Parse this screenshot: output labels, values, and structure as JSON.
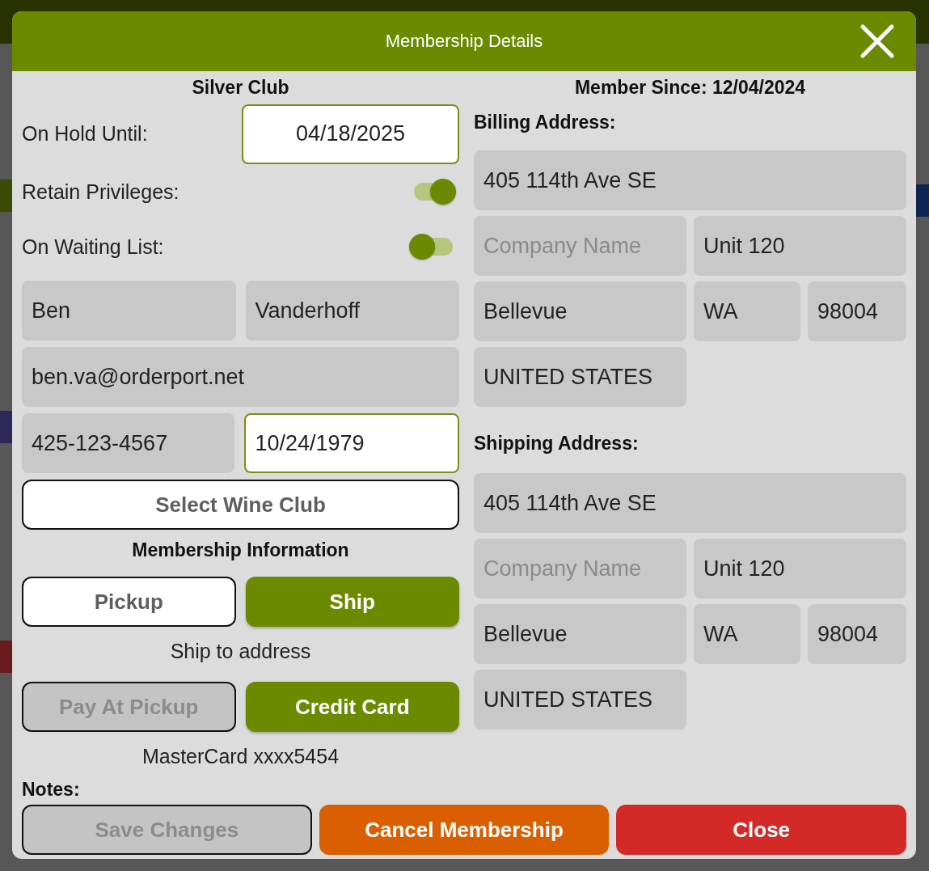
{
  "backdrop": {
    "left_edge": [
      {
        "color": "#3b4a05"
      },
      {
        "color": "#2e2858"
      },
      {
        "color": "#6a1c1c"
      }
    ],
    "right_edge": [
      {
        "color": "#0d2553"
      }
    ]
  },
  "dialog": {
    "title": "Membership Details",
    "club": "Silver Club",
    "member_since": "Member Since: 12/04/2024",
    "hold": {
      "label": "On Hold Until:",
      "value": "04/18/2025"
    },
    "toggles": [
      {
        "label": "Retain Privileges:",
        "on": true
      },
      {
        "label": "On Waiting List:",
        "on": false
      }
    ],
    "contact_rows": [
      [
        {
          "value": "Ben",
          "kind": "text"
        },
        {
          "value": "Vanderhoff",
          "kind": "text"
        }
      ],
      [
        {
          "value": "ben.va@orderport.net",
          "kind": "text"
        }
      ],
      [
        {
          "value": "425-123-4567",
          "kind": "text"
        },
        {
          "value": "10/24/1979",
          "kind": "date"
        }
      ]
    ],
    "select_club": "Select Wine Club",
    "membership_heading": "Membership Information",
    "delivery_options": [
      {
        "label": "Pickup",
        "selected": false,
        "disabled": false
      },
      {
        "label": "Ship",
        "selected": true,
        "disabled": false
      }
    ],
    "delivery_note": "Ship to address",
    "payment_options": [
      {
        "label": "Pay At Pickup",
        "selected": false,
        "disabled": true
      },
      {
        "label": "Credit Card",
        "selected": true,
        "disabled": false
      }
    ],
    "payment_note": "MasterCard xxxx5454",
    "notes_label": "Notes:",
    "addresses": [
      {
        "title": "Billing Address:",
        "rows": [
          [
            {
              "value": "405 114th Ave SE"
            }
          ],
          [
            {
              "placeholder": "Company Name"
            },
            {
              "value": "Unit 120"
            }
          ],
          [
            {
              "value": "Bellevue"
            },
            {
              "value": "WA"
            },
            {
              "value": "98004"
            }
          ],
          [
            {
              "value": "UNITED STATES"
            }
          ]
        ]
      },
      {
        "title": "Shipping Address:",
        "rows": [
          [
            {
              "value": "405 114th Ave SE"
            }
          ],
          [
            {
              "placeholder": "Company Name"
            },
            {
              "value": "Unit 120"
            }
          ],
          [
            {
              "value": "Bellevue"
            },
            {
              "value": "WA"
            },
            {
              "value": "98004"
            }
          ],
          [
            {
              "value": "UNITED STATES"
            }
          ]
        ]
      }
    ],
    "actions": [
      {
        "label": "Save Changes",
        "kind": "save",
        "disabled": true
      },
      {
        "label": "Cancel Membership",
        "kind": "cancel",
        "disabled": false
      },
      {
        "label": "Close",
        "kind": "close",
        "disabled": false
      }
    ]
  }
}
